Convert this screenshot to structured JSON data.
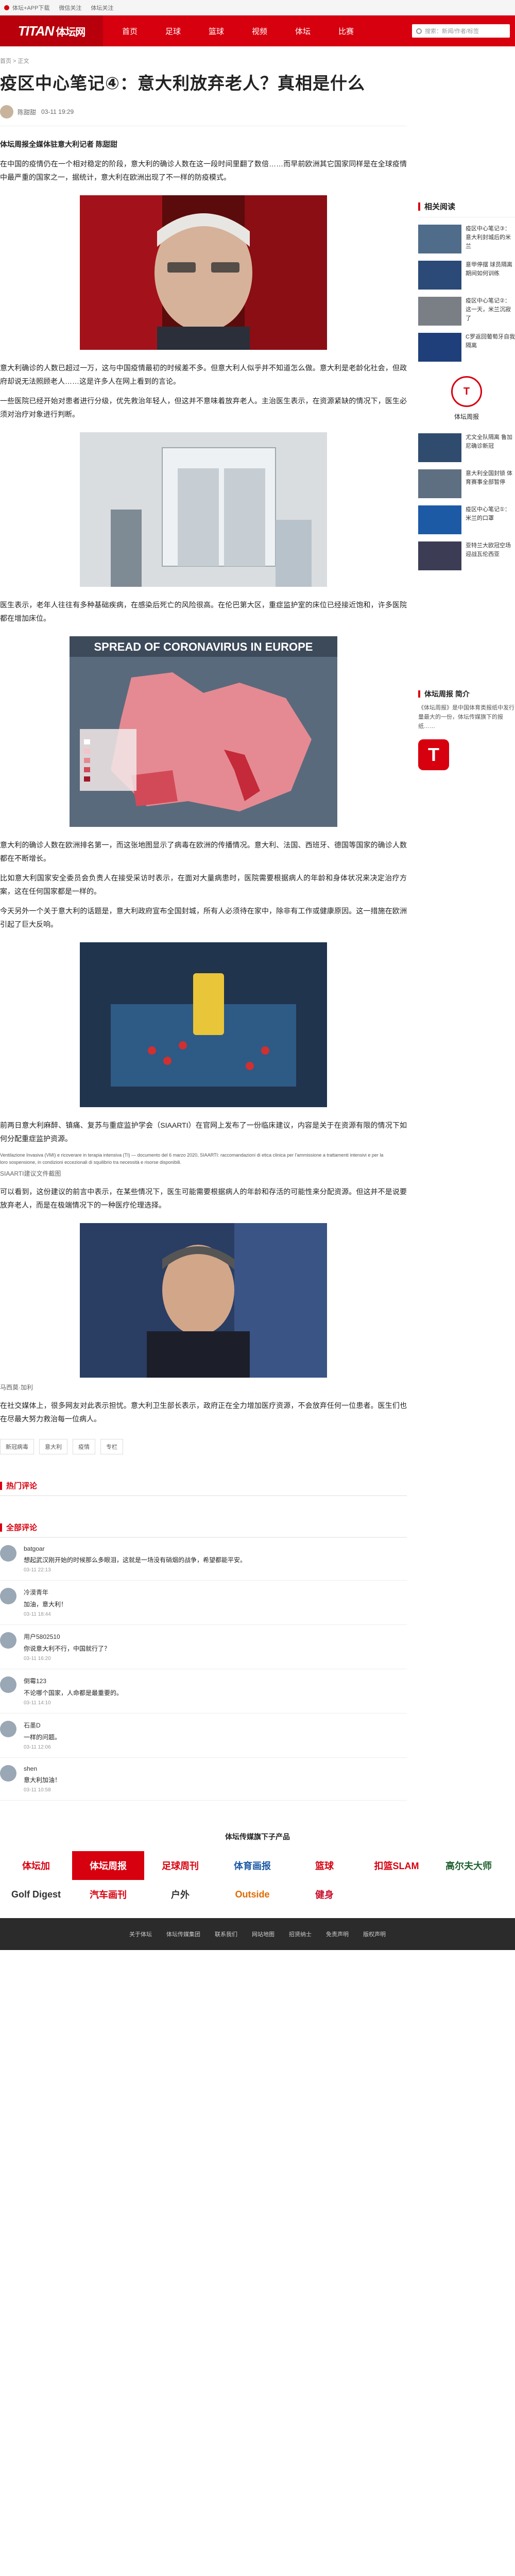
{
  "topbar": {
    "items": [
      "体坛+APP下载",
      "微信关注",
      "体坛关注"
    ]
  },
  "nav": {
    "logo": "TITAN",
    "logo_cn": "体坛网",
    "items": [
      "首页",
      "足球",
      "篮球",
      "视频",
      "体坛",
      "比赛"
    ],
    "search_placeholder": "搜索：新闻/作者/标签"
  },
  "breadcrumb": "首页 > 正文",
  "article": {
    "title": "疫区中心笔记④：意大利放弃老人？真相是什么",
    "author": "陈甜甜",
    "date": "03-11 19:29",
    "lead": "体坛周报全媒体驻意大利记者 陈甜甜",
    "p1": "在中国的疫情仍在一个相对稳定的阶段，意大利的确诊人数在这一段时间里翻了数倍……而早前欧洲其它国家同样是在全球疫情中最严重的国家之一，据统计，意大利在欧洲出现了不一样的防疫模式。",
    "p2": "意大利确诊的人数已超过一万，这与中国疫情最初的时候差不多。但意大利人似乎并不知道怎么做。意大利是老龄化社会，但政府却说无法照顾老人……这是许多人在网上看到的言论。",
    "p3": "一些医院已经开始对患者进行分级，优先救治年轻人，但这并不意味着放弃老人。主治医生表示，在资源紧缺的情况下，医生必须对治疗对象进行判断。",
    "p4": "医生表示，老年人往往有多种基础疾病，在感染后死亡的风险很高。在伦巴第大区，重症监护室的床位已经接近饱和，许多医院都在增加床位。",
    "p5": "意大利的确诊人数在欧洲排名第一，而这张地图显示了病毒在欧洲的传播情况。意大利、法国、西班牙、德国等国家的确诊人数都在不断增长。",
    "p6": "比如意大利国家安全委员会负责人在接受采访时表示，在面对大量病患时，医院需要根据病人的年龄和身体状况来决定治疗方案，这在任何国家都是一样的。",
    "p7": "今天另外一个关于意大利的话题是，意大利政府宣布全国封城，所有人必须待在家中，除非有工作或健康原因。这一措施在欧洲引起了巨大反响。",
    "p8": "前两日意大利麻醉、镇痛、复苏与重症监护学会（SIAARTI）在官网上发布了一份临床建议，内容是关于在资源有限的情况下如何分配重症监护资源。",
    "fineprint": "Ventilazione Invasiva (VMI) e ricoverare in terapia intensiva (TI) — documento del 6 marzo 2020, SIAARTI: raccomandazioni di etica clinica per l'ammissione a trattamenti intensivi e per la loro sospensione, in condizioni eccezionali di squilibrio tra necessità e risorse disponibili.",
    "caption1": "SIAARTI建议文件截图",
    "p9": "可以看到，这份建议的前言中表示，在某些情况下，医生可能需要根据病人的年龄和存活的可能性来分配资源。但这并不是说要放弃老人，而是在极端情况下的一种医疗伦理选择。",
    "caption2": "马西莫·加利",
    "p10": "在社交媒体上，很多网友对此表示担忧。意大利卫生部长表示，政府正在全力增加医疗资源，不会放弃任何一位患者。医生们也在尽最大努力救治每一位病人。",
    "tags": [
      "新冠病毒",
      "意大利",
      "疫情",
      "专栏"
    ]
  },
  "comments": {
    "hot_title": "热门评论",
    "all_title": "全部评论",
    "list": [
      {
        "name": "batgoar",
        "text": "想起武汉刚开始的时候那么多眼泪，这就是一场没有硝烟的战争，希望都能平安。",
        "time": "03-11 22:13"
      },
      {
        "name": "冷漠青年",
        "text": "加油，意大利！",
        "time": "03-11 18:44"
      },
      {
        "name": "用户5802510",
        "text": "你说意大利不行，中国就行了？",
        "time": "03-11 16:20"
      },
      {
        "name": "倒霉123",
        "text": "不论哪个国家，人命都是最重要的。",
        "time": "03-11 14:10"
      },
      {
        "name": "石墨D",
        "text": "一样的问题。",
        "time": "03-11 12:06"
      },
      {
        "name": "shen",
        "text": "意大利加油！",
        "time": "03-11 10:58"
      }
    ]
  },
  "side": {
    "related_title": "相关阅读",
    "related": [
      "疫区中心笔记③：意大利封城后的米兰",
      "意甲停摆 球员隔离期间如何训练",
      "疫区中心笔记②：这一天，米兰沉寂了",
      "C罗返回葡萄牙自我隔离",
      "尤文全队隔离 鲁加尼确诊新冠",
      "意大利全国封锁 体育赛事全部暂停",
      "疫区中心笔记①：米兰的口罩",
      "亚特兰大欧冠空场迎战瓦伦西亚"
    ],
    "author_name": "体坛周报",
    "intro_title": "体坛周报 简介",
    "intro_text": "《体坛周报》是中国体育类报纸中发行量最大的一份，体坛传媒旗下的报纸……",
    "app_letter": "T"
  },
  "brands_title": "体坛传媒旗下子产品",
  "brands": [
    "体坛加",
    "体坛周报",
    "足球周刊",
    "体育画报",
    "篮球",
    "扣篮SLAM",
    "高尔夫大师",
    "Golf Digest",
    "汽车画刊",
    "户外",
    "Outside",
    "健身"
  ],
  "footer": [
    "关于体坛",
    "体坛传媒集团",
    "联系我们",
    "网站地图",
    "招贤纳士",
    "免责声明",
    "版权声明"
  ],
  "colors": {
    "brand_red": "#d7000f",
    "footer_bg": "#2b2b2b"
  }
}
